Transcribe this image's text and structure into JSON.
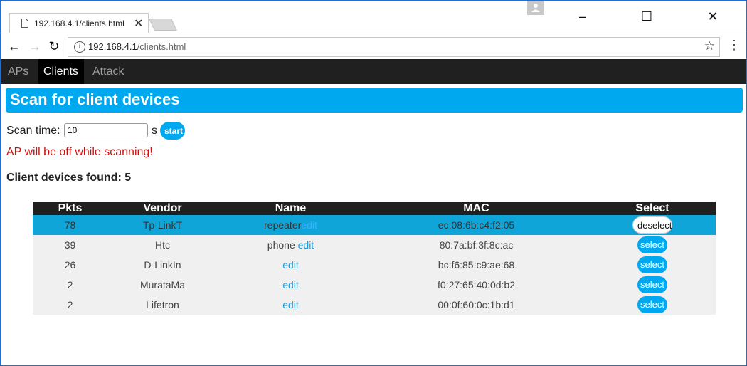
{
  "browser": {
    "tab_title": "192.168.4.1/clients.html",
    "url_host": "192.168.4.1",
    "url_path": "/clients.html"
  },
  "nav": {
    "items": [
      {
        "label": "APs",
        "active": false
      },
      {
        "label": "Clients",
        "active": true
      },
      {
        "label": "Attack",
        "active": false
      }
    ]
  },
  "page": {
    "title": "Scan for client devices",
    "scan_label": "Scan time:",
    "scan_value": "10",
    "scan_unit": "s",
    "start_label": "start",
    "warning": "AP will be off while scanning!",
    "found_label": "Client devices found: 5"
  },
  "table": {
    "headers": [
      "Pkts",
      "Vendor",
      "Name",
      "MAC",
      "Select"
    ],
    "rows": [
      {
        "pkts": "78",
        "vendor": "Tp-LinkT",
        "name": "repeater",
        "edit": "edit",
        "mac": "ec:08:6b:c4:f2:05",
        "action": "deselect",
        "selected": true
      },
      {
        "pkts": "39",
        "vendor": "Htc",
        "name": "phone",
        "edit": "edit",
        "mac": "80:7a:bf:3f:8c:ac",
        "action": "select",
        "selected": false
      },
      {
        "pkts": "26",
        "vendor": "D-LinkIn",
        "name": "",
        "edit": "edit",
        "mac": "bc:f6:85:c9:ae:68",
        "action": "select",
        "selected": false
      },
      {
        "pkts": "2",
        "vendor": "MurataMa",
        "name": "",
        "edit": "edit",
        "mac": "f0:27:65:40:0d:b2",
        "action": "select",
        "selected": false
      },
      {
        "pkts": "2",
        "vendor": "Lifetron",
        "name": "",
        "edit": "edit",
        "mac": "00:0f:60:0c:1b:d1",
        "action": "select",
        "selected": false
      }
    ]
  },
  "colors": {
    "accent": "#00a8f0",
    "nav_bg": "#202020",
    "selected_row": "#10a5d8",
    "warning": "#cc1010"
  }
}
